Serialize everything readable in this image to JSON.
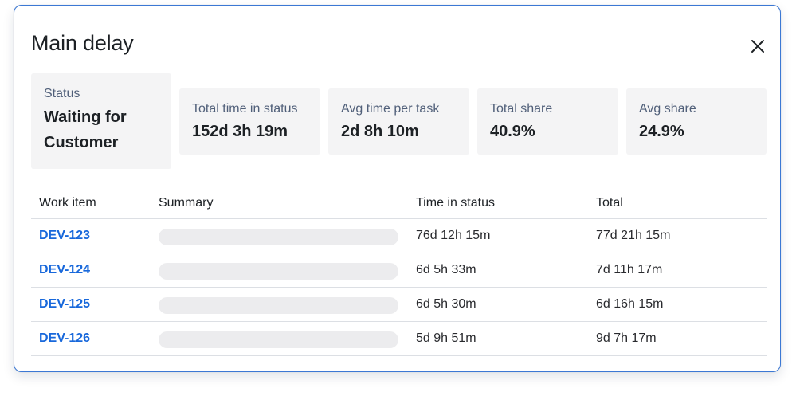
{
  "dialog": {
    "title": "Main delay",
    "close_icon": "close-icon"
  },
  "stats": {
    "status": {
      "label": "Status",
      "value_line1": "Waiting for",
      "value_line2": "Customer"
    },
    "total_time": {
      "label": "Total time in status",
      "value": "152d 3h 19m"
    },
    "avg_time": {
      "label": "Avg time per task",
      "value": "2d 8h 10m"
    },
    "total_share": {
      "label": "Total share",
      "value": "40.9%"
    },
    "avg_share": {
      "label": "Avg share",
      "value": "24.9%"
    }
  },
  "table": {
    "headers": {
      "work_item": "Work item",
      "summary": "Summary",
      "time_in_status": "Time in status",
      "total": "Total"
    },
    "rows": [
      {
        "key": "DEV-123",
        "time_in_status": "76d 12h 15m",
        "total": "77d 21h 15m"
      },
      {
        "key": "DEV-124",
        "time_in_status": "6d 5h 33m",
        "total": "7d 11h 17m"
      },
      {
        "key": "DEV-125",
        "time_in_status": "6d 5h 30m",
        "total": "6d 16h 15m"
      },
      {
        "key": "DEV-126",
        "time_in_status": "5d 9h 51m",
        "total": "9d 7h 17m"
      }
    ]
  },
  "colors": {
    "accent_border": "#3b78d4",
    "link": "#1868db",
    "stat_background": "#f4f4f5",
    "skeleton": "#ececee"
  }
}
